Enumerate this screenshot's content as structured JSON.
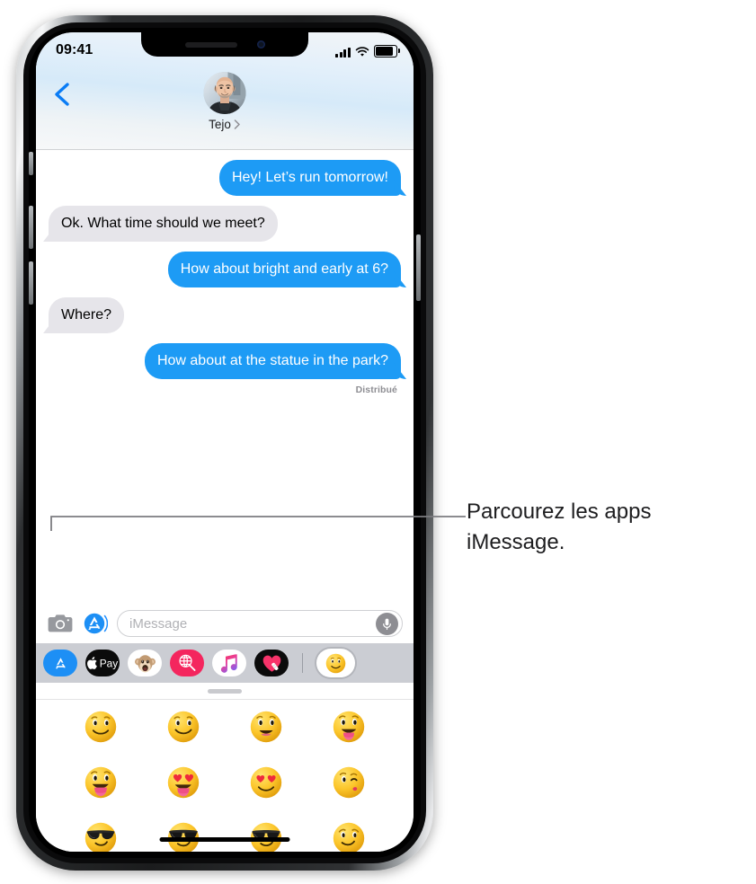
{
  "status_bar": {
    "time": "09:41",
    "cellular_icon": "signal-bars-icon",
    "wifi_icon": "wifi-icon",
    "battery_icon": "battery-full-icon"
  },
  "header": {
    "back_icon": "back-chevron-icon",
    "contact_name": "Tejo",
    "contact_chevron_icon": "chevron-right-icon",
    "avatar_icon": "contact-avatar-photo"
  },
  "conversation": {
    "messages": [
      {
        "id": 1,
        "direction": "outgoing",
        "text": "Hey! Let’s run tomorrow!"
      },
      {
        "id": 2,
        "direction": "incoming",
        "text": "Ok. What time should we meet?"
      },
      {
        "id": 3,
        "direction": "outgoing",
        "text": "How about bright and early at 6?"
      },
      {
        "id": 4,
        "direction": "incoming",
        "text": "Where?"
      },
      {
        "id": 5,
        "direction": "outgoing",
        "text": "How about at the statue in the park?"
      }
    ],
    "delivery_status": "Distribué"
  },
  "input_bar": {
    "camera_icon": "camera-icon",
    "appstore_toggle_icon": "app-store-icon",
    "placeholder": "iMessage",
    "mic_icon": "microphone-icon"
  },
  "app_drawer": {
    "apps": [
      {
        "name": "app-store",
        "label": "App Store",
        "icon": "app-store-icon",
        "selected": false
      },
      {
        "name": "apple-pay",
        "label": "Apple Pay",
        "icon": "apple-pay-icon",
        "selected": false
      },
      {
        "name": "memoji",
        "label": "Memoji",
        "icon": "memoji-monkey-icon",
        "selected": false
      },
      {
        "name": "images",
        "label": "#images",
        "icon": "gif-search-icon",
        "selected": false
      },
      {
        "name": "music",
        "label": "Music",
        "icon": "apple-music-icon",
        "selected": false
      },
      {
        "name": "digital-touch",
        "label": "Digital Touch",
        "icon": "digital-touch-heart-icon",
        "selected": false
      }
    ],
    "selected_app": {
      "name": "emoji-stickers",
      "label": "Smileys",
      "icon": "smiley-sticker-icon",
      "selected": true
    }
  },
  "sticker_panel": {
    "grabber_icon": "drag-handle-icon",
    "stickers": [
      {
        "id": 1,
        "name": "smiley-slight-smile",
        "icon": "🙂"
      },
      {
        "id": 2,
        "name": "smiley-smile",
        "icon": "🙂"
      },
      {
        "id": 3,
        "name": "smiley-open-mouth-smile",
        "icon": "😃"
      },
      {
        "id": 4,
        "name": "smiley-tongue-out",
        "icon": "😛"
      },
      {
        "id": 5,
        "name": "smiley-big-tongue-out",
        "icon": "😛"
      },
      {
        "id": 6,
        "name": "smiley-heart-eyes-tongue",
        "icon": "😍"
      },
      {
        "id": 7,
        "name": "smiley-heart-eyes",
        "icon": "😍"
      },
      {
        "id": 8,
        "name": "smiley-kiss-wink",
        "icon": "😘"
      },
      {
        "id": 9,
        "name": "smiley-sunglasses-a",
        "icon": "😎"
      },
      {
        "id": 10,
        "name": "smiley-sunglasses-b",
        "icon": "😎"
      },
      {
        "id": 11,
        "name": "smiley-sunglasses-c",
        "icon": "😎"
      },
      {
        "id": 12,
        "name": "smiley-smirk",
        "icon": "😏"
      }
    ],
    "home_indicator": "home-indicator"
  },
  "callout": {
    "text": "Parcourez les apps iMessage.",
    "leader_icon": "callout-leader-line"
  },
  "colors": {
    "outgoing_bubble": "#1d9bf5",
    "incoming_bubble": "#e6e5ea",
    "accent_blue": "#0a84ff",
    "drawer_background": "#cbcdd3",
    "delivered_text": "#8e8e93"
  }
}
